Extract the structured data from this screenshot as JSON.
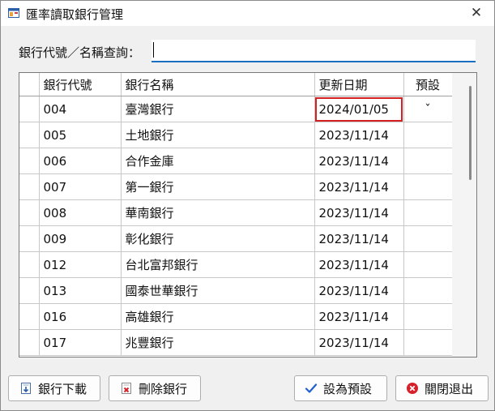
{
  "window": {
    "title": "匯率讀取銀行管理",
    "close_glyph": "✕"
  },
  "search": {
    "label": "銀行代號／名稱查詢：",
    "value": ""
  },
  "grid": {
    "columns": [
      "",
      "銀行代號",
      "銀行名稱",
      "更新日期",
      "預設"
    ],
    "rows": [
      {
        "code": "004",
        "name": "臺灣銀行",
        "date": "2024/01/05",
        "default": "ˇ"
      },
      {
        "code": "005",
        "name": "土地銀行",
        "date": "2023/11/14",
        "default": ""
      },
      {
        "code": "006",
        "name": "合作金庫",
        "date": "2023/11/14",
        "default": ""
      },
      {
        "code": "007",
        "name": "第一銀行",
        "date": "2023/11/14",
        "default": ""
      },
      {
        "code": "008",
        "name": "華南銀行",
        "date": "2023/11/14",
        "default": ""
      },
      {
        "code": "009",
        "name": "彰化銀行",
        "date": "2023/11/14",
        "default": ""
      },
      {
        "code": "012",
        "name": "台北富邦銀行",
        "date": "2023/11/14",
        "default": ""
      },
      {
        "code": "013",
        "name": "國泰世華銀行",
        "date": "2023/11/14",
        "default": ""
      },
      {
        "code": "016",
        "name": "高雄銀行",
        "date": "2023/11/14",
        "default": ""
      },
      {
        "code": "017",
        "name": "兆豐銀行",
        "date": "2023/11/14",
        "default": ""
      }
    ],
    "highlight_color": "#d42020"
  },
  "buttons": {
    "download": "銀行下載",
    "delete": "刪除銀行",
    "set_default": "設為預設",
    "close": "關閉退出"
  },
  "icons": {
    "app": "window-app-icon",
    "download": "download-doc-icon",
    "delete": "delete-doc-icon",
    "set_default": "checkmark-icon",
    "close": "close-circle-icon"
  },
  "colors": {
    "accent": "#1a6fc1",
    "check_blue": "#1f5fd0",
    "close_red": "#d6202a"
  }
}
